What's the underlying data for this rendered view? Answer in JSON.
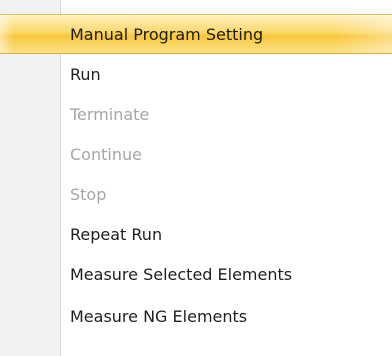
{
  "menu": {
    "items": [
      {
        "label": "Manual Program Setting",
        "state": "highlighted"
      },
      {
        "label": "Run",
        "state": "enabled"
      },
      {
        "label": "Terminate",
        "state": "disabled"
      },
      {
        "label": "Continue",
        "state": "disabled"
      },
      {
        "label": "Stop",
        "state": "disabled"
      },
      {
        "label": "Repeat Run",
        "state": "enabled"
      },
      {
        "label": "Measure Selected Elements",
        "state": "enabled"
      },
      {
        "label": "Measure NG Elements",
        "state": "enabled"
      }
    ]
  },
  "colors": {
    "highlight": "#fbd96a",
    "text_enabled": "#1e1e1e",
    "text_disabled": "#a6a6a6",
    "gutter": "#f2f2f2"
  }
}
